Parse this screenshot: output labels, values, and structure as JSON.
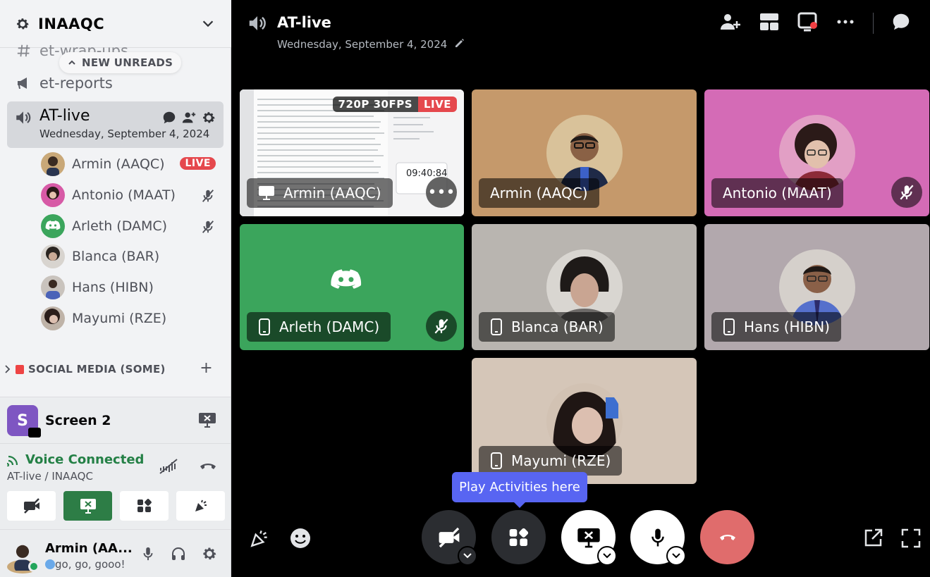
{
  "server": {
    "name": "INAAQC"
  },
  "channels": {
    "wrap_ups": "et-wrap-ups",
    "reports": "et-reports",
    "new_unreads": "NEW UNREADS"
  },
  "active_channel": {
    "name": "AT-live",
    "date": "Wednesday, September 4, 2024"
  },
  "voice_users": [
    {
      "name": "Armin (AAQC)",
      "live": "LIVE"
    },
    {
      "name": "Antonio (MAAT)"
    },
    {
      "name": "Arleth (DAMC)"
    },
    {
      "name": "Blanca (BAR)"
    },
    {
      "name": "Hans (HIBN)"
    },
    {
      "name": "Mayumi (RZE)"
    }
  ],
  "category": {
    "name": "SOCIAL MEDIA (SOME)"
  },
  "screen_panel": {
    "initial": "S",
    "label": "Screen 2"
  },
  "voice_panel": {
    "status": "Voice Connected",
    "location": "AT-live / INAAQC"
  },
  "user_panel": {
    "name": "Armin (AA...",
    "status": "go, go, gooo!"
  },
  "main": {
    "title": "AT-live",
    "date": "Wednesday, September 4, 2024"
  },
  "tiles": [
    {
      "name": "Armin (AAQC)",
      "quality": "720P 30FPS",
      "live": "LIVE",
      "clock": "09:40:84"
    },
    {
      "name": "Armin (AAQC)"
    },
    {
      "name": "Antonio (MAAT)"
    },
    {
      "name": "Arleth (DAMC)"
    },
    {
      "name": "Blanca (BAR)"
    },
    {
      "name": "Hans (HIBN)"
    },
    {
      "name": "Mayumi (RZE)"
    }
  ],
  "tooltip": "Play Activities here",
  "colors": {
    "accent": "#5865f2",
    "live": "#e5484d",
    "voice_green": "#248046",
    "arleth_tile": "#3ba55c",
    "hangup": "#e06c6c"
  }
}
